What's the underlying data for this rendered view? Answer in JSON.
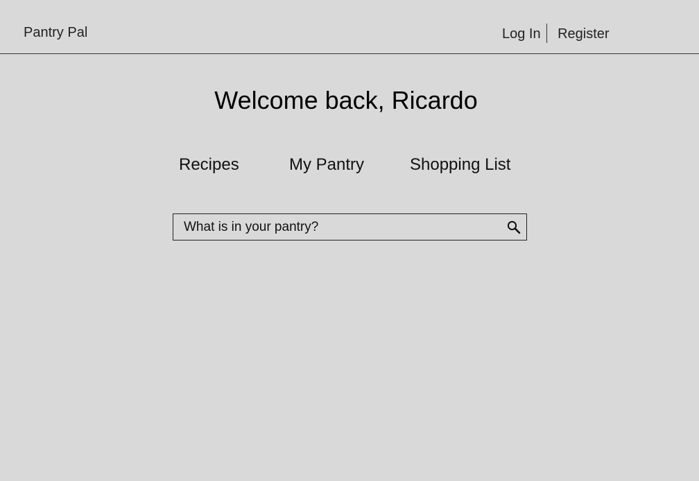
{
  "header": {
    "brand": "Pantry Pal",
    "login_label": "Log In",
    "register_label": "Register"
  },
  "main": {
    "welcome": "Welcome back, Ricardo",
    "tabs": [
      {
        "label": "Recipes"
      },
      {
        "label": "My Pantry"
      },
      {
        "label": "Shopping List"
      }
    ]
  },
  "search": {
    "placeholder": "What is in your pantry?",
    "value": "",
    "icon": "search-icon"
  }
}
